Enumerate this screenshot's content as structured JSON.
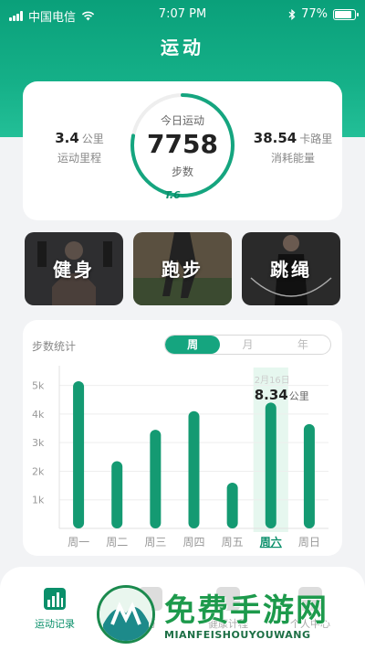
{
  "status_bar": {
    "carrier": "中国电信",
    "time": "7:07 PM",
    "battery": "77%"
  },
  "header": {
    "title": "运动"
  },
  "summary": {
    "distance_value": "3.4",
    "distance_unit": "公里",
    "distance_label": "运动里程",
    "ring_label": "今日运动",
    "steps_value": "7758",
    "steps_unit": "步数",
    "date_mark": "T.6",
    "calories_value": "38.54",
    "calories_unit": "卡路里",
    "calories_label": "消耗能量",
    "ring_progress": 0.78
  },
  "categories": [
    {
      "label": "健身",
      "bg": "#3a3a3a"
    },
    {
      "label": "跑步",
      "bg": "#4a4638"
    },
    {
      "label": "跳绳",
      "bg": "#2f2f2f"
    }
  ],
  "chart_card": {
    "title": "步数统计",
    "tabs": [
      "周",
      "月",
      "年"
    ],
    "active_tab": 0
  },
  "chart_data": {
    "type": "bar",
    "title": "步数统计",
    "categories": [
      "周一",
      "周二",
      "周三",
      "周四",
      "周五",
      "周六",
      "周日"
    ],
    "values": [
      5150,
      2350,
      3450,
      4100,
      1600,
      4400,
      3650
    ],
    "ylim": [
      0,
      5500
    ],
    "yticks": [
      1000,
      2000,
      3000,
      4000,
      5000
    ],
    "ytick_labels": [
      "1k",
      "2k",
      "3k",
      "4k",
      "5k"
    ],
    "highlight_index": 5,
    "highlight_date": "2月16日",
    "highlight_value": "8.34",
    "highlight_unit": "公里",
    "bar_color": "#149a72",
    "highlight_bg": "#e6f7ef",
    "grid": true
  },
  "bottom_nav": {
    "items": [
      {
        "label": "运动记录",
        "icon": "chart-bars-icon",
        "active": true
      },
      {
        "label": "历",
        "icon": "calendar-icon",
        "active": false
      },
      {
        "label": "健康计程",
        "icon": "health-icon",
        "active": false
      },
      {
        "label": "个人中心",
        "icon": "person-icon",
        "active": false
      }
    ]
  },
  "watermark": {
    "title": "免费手游网",
    "subtitle": "MIANFEISHOUYOUWANG"
  },
  "colors": {
    "accent": "#15a57f",
    "accent_dark": "#0a8f6a"
  }
}
